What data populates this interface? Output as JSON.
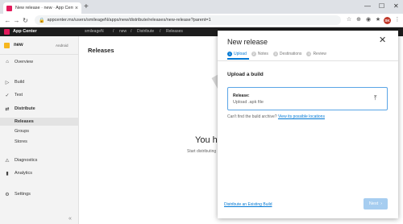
{
  "browser": {
    "tab_title": "New release · new · App Center",
    "tab_close": "×",
    "new_tab": "+",
    "url": "appcenter.ms/users/smileageN/apps/new/distribute/releases/new-release?parent=1",
    "lock": "🔒",
    "back": "←",
    "forward": "→",
    "reload": "↻",
    "star": "☆",
    "extensions": [
      "⊕",
      "◉",
      "★"
    ],
    "avatar": "SK",
    "menu": "⋮",
    "win_min": "—",
    "win_max": "☐",
    "win_close": "✕"
  },
  "app_header": {
    "title": "App Center",
    "breadcrumbs": [
      "smileageN",
      "/",
      "new",
      "/",
      "Distribute",
      "/",
      "Releases"
    ]
  },
  "sidebar": {
    "app_name": "new",
    "app_os": "Android",
    "items": {
      "overview": "Overview",
      "build": "Build",
      "test": "Test",
      "distribute": "Distribute",
      "releases": "Releases",
      "groups": "Groups",
      "stores": "Stores",
      "diagnostics": "Diagnostics",
      "analytics": "Analytics",
      "settings": "Settings"
    },
    "collapse": "«"
  },
  "main": {
    "title": "Releases",
    "empty_title": "You ha",
    "empty_sub": "Start distributing"
  },
  "panel": {
    "title": "New release",
    "close": "✕",
    "steps": [
      {
        "num": "1",
        "label": "Upload"
      },
      {
        "num": "2",
        "label": "Notes"
      },
      {
        "num": "3",
        "label": "Destinations"
      },
      {
        "num": "4",
        "label": "Review"
      }
    ],
    "section_title": "Upload a build",
    "upload_label": "Release:",
    "upload_placeholder": "Upload .apk file",
    "upload_icon": "⤒",
    "hint_text": "Can't find the build archive?",
    "hint_link": "View its possible locations",
    "distribute_existing": "Distribute an Existing Build",
    "next": "Next",
    "next_icon": "›"
  },
  "colors": {
    "accent": "#0078d4",
    "brand": "#e2195b",
    "app_icon": "#f6b61e",
    "header_bg": "#1c1c1c",
    "disabled_button": "#a6cdf0"
  }
}
